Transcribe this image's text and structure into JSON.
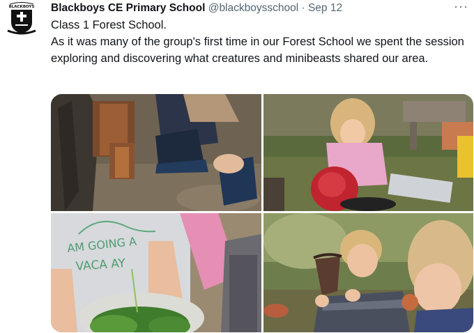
{
  "tweet": {
    "author_name": "Blackboys CE Primary School",
    "handle": "@blackboysschool",
    "separator": "·",
    "date": "Sep 12",
    "more": "···",
    "text_line1": "Class 1 Forest School.",
    "text_line2": "As it was many of the group's first time in our Forest School we spent the session exploring and discovering what creatures and minibeasts shared our area."
  },
  "avatar": {
    "crest_text": "BLACKBOYS"
  },
  "photos": [
    {
      "label": "photo-1"
    },
    {
      "label": "photo-2"
    },
    {
      "label": "photo-3",
      "shirt_text_1": "AM GOING A",
      "shirt_text_2": "VACA AY"
    },
    {
      "label": "photo-4"
    }
  ]
}
